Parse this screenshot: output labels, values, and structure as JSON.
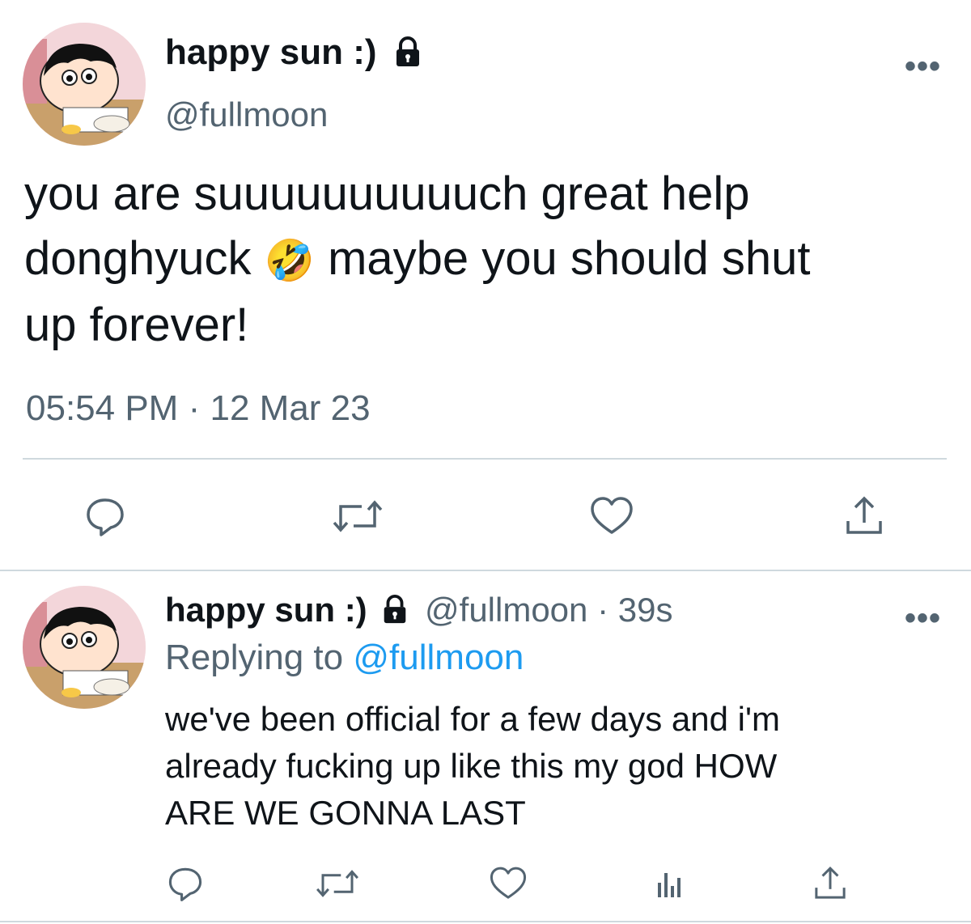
{
  "tweet": {
    "display_name": "happy sun :)",
    "handle": "@fullmoon",
    "text_line1": "you are suuuuuuuuuuch great help",
    "text_line2_a": "donghyuck",
    "text_emoji": "🤣",
    "text_line2_b": "maybe you should shut",
    "text_line3": "up forever!",
    "time": "05:54 PM",
    "separator": "·",
    "date": "12 Mar 23",
    "more": "•••",
    "lock_icon": "lock-icon"
  },
  "reply": {
    "display_name": "happy sun :)",
    "handle": "@fullmoon",
    "separator": "·",
    "age": "39s",
    "replying_prefix": "Replying to",
    "replying_handle": "@fullmoon",
    "text_line1": "we've been official for a few days and i'm",
    "text_line2": "already fucking up like this my god HOW",
    "text_line3": "ARE WE GONNA LAST",
    "more": "•••"
  },
  "colors": {
    "text": "#0f1419",
    "secondary": "#536471",
    "accent": "#1d9bf0",
    "divider": "#cfd9de"
  }
}
